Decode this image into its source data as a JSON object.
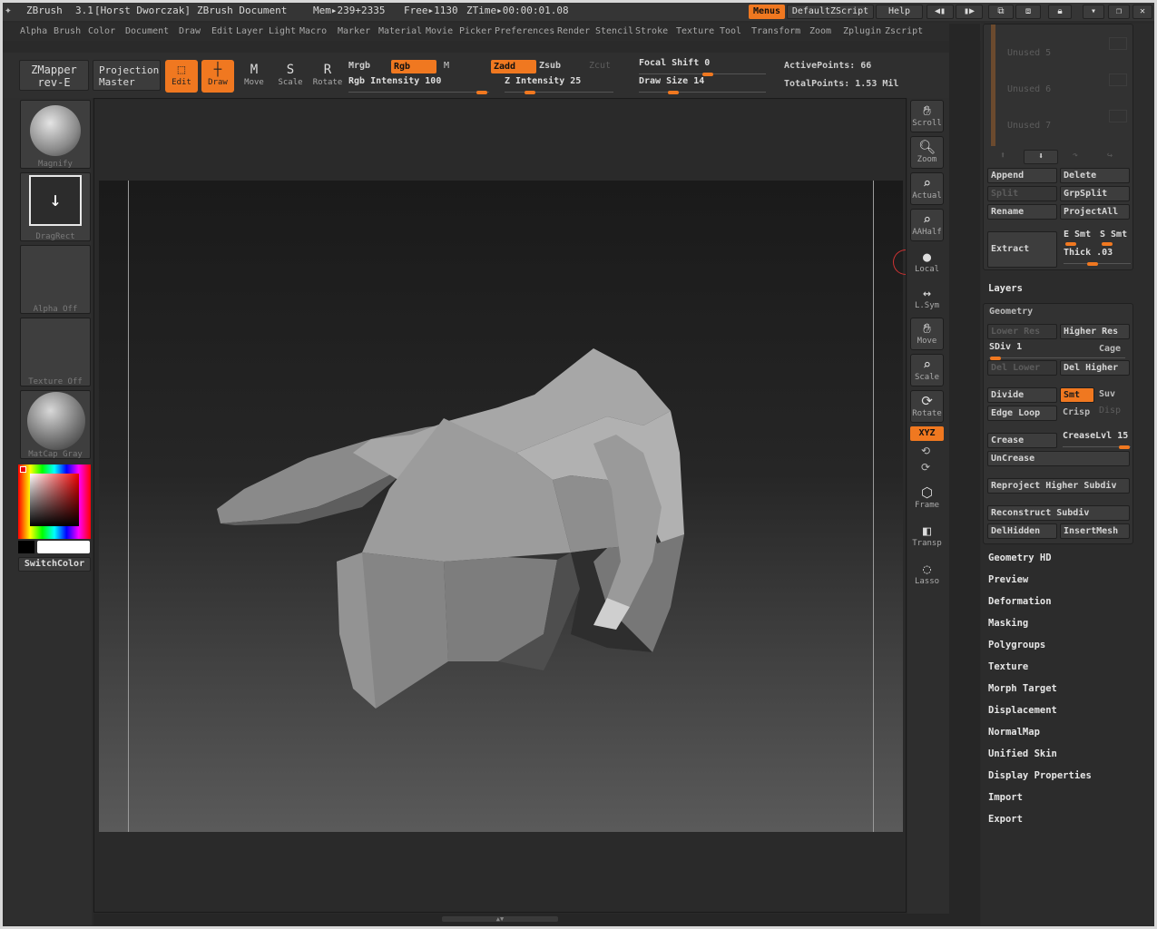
{
  "title": {
    "app": "ZBrush",
    "version": "3.1",
    "author": "[Horst Dworczak]",
    "doc": "ZBrush Document",
    "mem": "Mem▸239+2335",
    "free": "Free▸1130",
    "ztime": "ZTime▸00:00:01.08"
  },
  "titlebar_buttons": {
    "menus": "Menus",
    "script": "DefaultZScript",
    "help": "Help"
  },
  "menu": [
    "Alpha",
    "Brush",
    "Color",
    "Document",
    "Draw",
    "Edit",
    "Layer",
    "Light",
    "Macro",
    "Marker",
    "Material",
    "Movie",
    "Picker",
    "Preferences",
    "Render",
    "Stencil",
    "Stroke",
    "Texture",
    "Tool",
    "Transform",
    "Zoom",
    "Zplugin",
    "Zscript"
  ],
  "plugin": {
    "zmapper_1": "ZMapper",
    "zmapper_2": "rev-E",
    "proj_1": "Projection",
    "proj_2": "Master"
  },
  "tools": {
    "edit": "Edit",
    "draw": "Draw",
    "move": "Move",
    "scale": "Scale",
    "rotate": "Rotate"
  },
  "color_modes": {
    "mrgb": "Mrgb",
    "rgb": "Rgb",
    "m": "M",
    "rgb_intensity": "Rgb Intensity 100"
  },
  "z_modes": {
    "zadd": "Zadd",
    "zsub": "Zsub",
    "zcut": "Zcut",
    "z_intensity": "Z Intensity 25"
  },
  "brush": {
    "focal_shift": "Focal Shift 0",
    "draw_size": "Draw Size 14"
  },
  "stats": {
    "active_points": "ActivePoints: 66",
    "total_points": "TotalPoints: 1.53 Mil"
  },
  "left": {
    "magnify": "Magnify",
    "dragrect": "DragRect",
    "alpha": "Alpha Off",
    "texture": "Texture Off",
    "matcap": "MatCap Gray",
    "switch": "SwitchColor"
  },
  "right": {
    "scroll": "Scroll",
    "zoom": "Zoom",
    "actual": "Actual",
    "aahalf": "AAHalf",
    "local": "Local",
    "lsym": "L.Sym",
    "move": "Move",
    "scale": "Scale",
    "rotate": "Rotate",
    "xyz": "XYZ",
    "frame": "Frame",
    "transp": "Transp",
    "lasso": "Lasso"
  },
  "subtool": {
    "unused5": "Unused 5",
    "unused6": "Unused 6",
    "unused7": "Unused 7",
    "append": "Append",
    "delete": "Delete",
    "split": "Split",
    "grpsplit": "GrpSplit",
    "rename": "Rename",
    "projectall": "ProjectAll",
    "extract": "Extract",
    "esmt": "E Smt",
    "ssmt": "S Smt",
    "thick": "Thick .03"
  },
  "layers": "Layers",
  "geometry": {
    "title": "Geometry",
    "lower": "Lower Res",
    "higher": "Higher Res",
    "sdiv": "SDiv 1",
    "cage": "Cage",
    "dellower": "Del Lower",
    "delhigher": "Del Higher",
    "divide": "Divide",
    "smt": "Smt",
    "suv": "Suv",
    "edgeloop": "Edge Loop",
    "crisp": "Crisp",
    "disp": "Disp",
    "crease": "Crease",
    "creaselvl": "CreaseLvl 15",
    "uncrease": "UnCrease",
    "reproject": "Reproject Higher Subdiv",
    "reconstruct": "Reconstruct Subdiv",
    "delhidden": "DelHidden",
    "insertmesh": "InsertMesh"
  },
  "sections": [
    "Geometry HD",
    "Preview",
    "Deformation",
    "Masking",
    "Polygroups",
    "Texture",
    "Morph Target",
    "Displacement",
    "NormalMap",
    "Unified Skin",
    "Display Properties",
    "Import",
    "Export"
  ],
  "colors": {
    "accent": "#f07820",
    "bg": "#2a2a2a"
  }
}
